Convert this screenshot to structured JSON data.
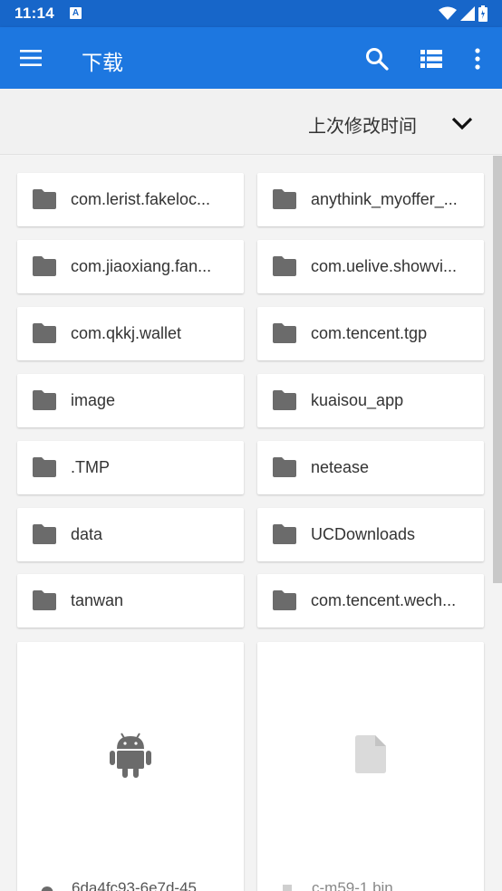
{
  "status_bar": {
    "time": "11:14",
    "notification_letter": "A"
  },
  "app_bar": {
    "title": "下载"
  },
  "sort_bar": {
    "label": "上次修改时间"
  },
  "folders": [
    {
      "name": "com.lerist.fakeloc..."
    },
    {
      "name": "anythink_myoffer_..."
    },
    {
      "name": "com.jiaoxiang.fan..."
    },
    {
      "name": "com.uelive.showvi..."
    },
    {
      "name": "com.qkkj.wallet"
    },
    {
      "name": "com.tencent.tgp"
    },
    {
      "name": "image"
    },
    {
      "name": "kuaisou_app"
    },
    {
      "name": ".TMP"
    },
    {
      "name": "netease"
    },
    {
      "name": "data"
    },
    {
      "name": "UCDownloads"
    },
    {
      "name": "tanwan"
    },
    {
      "name": "com.tencent.wech..."
    }
  ],
  "files": [
    {
      "name": "6da4fc93-6e7d-45",
      "icon": "android-icon"
    },
    {
      "name": "c-m59-1.bin",
      "icon": "file-icon"
    }
  ],
  "colors": {
    "status_bar": "#1766c9",
    "app_bar": "#1d77e0",
    "folder_icon": "#6b6b6b"
  }
}
